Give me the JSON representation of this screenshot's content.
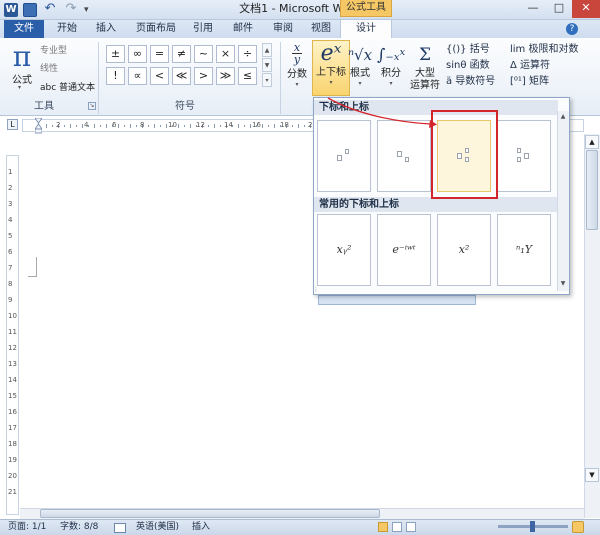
{
  "window": {
    "app_letter": "W",
    "title": "文档1 - Microsoft Word",
    "context_tab_header": "公式工具",
    "controls": {
      "minimize": "—",
      "maximize": "□",
      "close": "✕"
    },
    "quick_access": {
      "undo": "↶",
      "redo": "↷",
      "more": "▾"
    }
  },
  "tabs": {
    "file": "文件",
    "home": "开始",
    "insert": "插入",
    "layout": "页面布局",
    "references": "引用",
    "mailings": "邮件",
    "review": "审阅",
    "view": "视图",
    "design": "设计",
    "help": "?"
  },
  "ribbon": {
    "tools": {
      "label": "工具",
      "equation": {
        "glyph": "π",
        "label": "公式",
        "arrow": "▾"
      },
      "professional": "专业型",
      "linear": "线性",
      "normal_text": "abc 普通文本"
    },
    "symbols": {
      "label": "符号",
      "row1": [
        "±",
        "∞",
        "=",
        "≠",
        "~",
        "×",
        "÷"
      ],
      "row2": [
        "!",
        "∝",
        "<",
        "≪",
        ">",
        "≫",
        "≤"
      ],
      "scroll": [
        "▲",
        "▼",
        "▾"
      ]
    },
    "structures": {
      "fraction": {
        "glyph_top": "x",
        "glyph_bottom": "y",
        "label": "分数"
      },
      "script": {
        "glyph": "eˣ",
        "label": "上下标"
      },
      "radical": {
        "glyph": "ⁿ√x",
        "label": "根式"
      },
      "integral": {
        "glyph": "∫₋ₓˣ",
        "label": "积分"
      },
      "large_operator": {
        "glyph": "Σ",
        "label_line1": "大型",
        "label_line2": "运算符"
      },
      "bracket": "{()} 括号",
      "function": "sinθ 函数",
      "accent": "ä 导数符号",
      "limit_log": "lim 极限和对数",
      "operator": "Δ 运算符",
      "matrix": "[⁰¹] 矩阵"
    }
  },
  "gallery": {
    "section1": "下标和上标",
    "section2": "常用的下标和上标",
    "formulas": [
      "xᵧ²",
      "e⁻ⁱʷᵗ",
      "x²",
      "ⁿ₁Y"
    ],
    "scroll_up": "▲",
    "scroll_down": "▼"
  },
  "ruler": {
    "corner": "L",
    "numbers": [
      "2",
      "4",
      "6",
      "8",
      "10",
      "12",
      "14",
      "16",
      "18",
      "20",
      "22",
      "24",
      "26",
      "28",
      "30",
      "32",
      "34",
      "36"
    ],
    "vertical_numbers": [
      "1",
      "2",
      "3",
      "4",
      "5",
      "6",
      "7",
      "8",
      "9",
      "10",
      "11",
      "12",
      "13",
      "14",
      "15",
      "16",
      "17",
      "18",
      "19",
      "20",
      "21"
    ]
  },
  "status": {
    "page": "页面: 1/1",
    "words": "字数: 8/8",
    "language": "英语(美国)",
    "mode": "插入",
    "scroll_up": "▲",
    "scroll_down": "▼"
  }
}
